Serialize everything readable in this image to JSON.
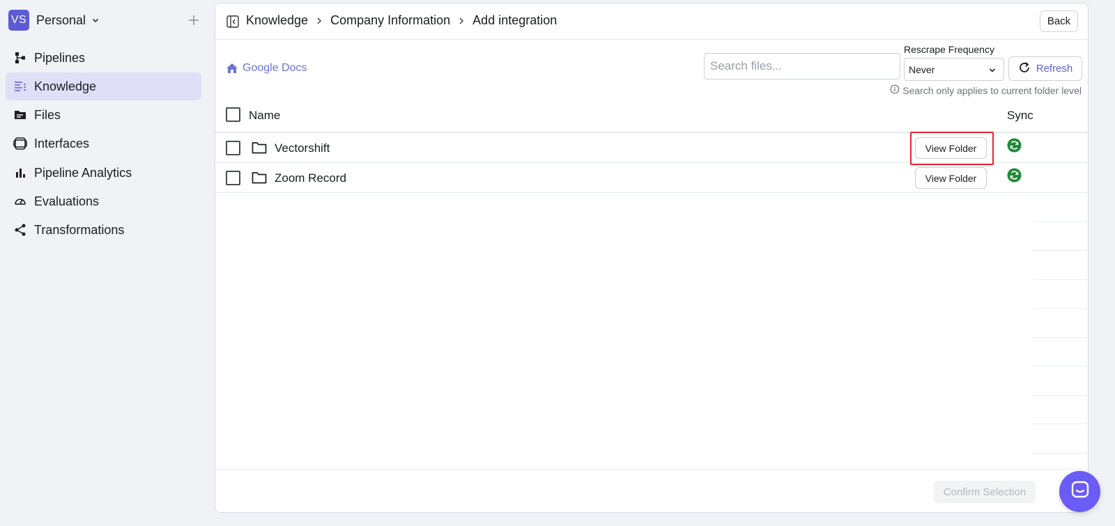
{
  "workspace": {
    "avatar": "VS",
    "name": "Personal"
  },
  "sidebar": {
    "items": [
      {
        "label": "Pipelines",
        "icon": "pipelines-icon"
      },
      {
        "label": "Knowledge",
        "icon": "knowledge-icon",
        "active": true
      },
      {
        "label": "Files",
        "icon": "files-icon"
      },
      {
        "label": "Interfaces",
        "icon": "interfaces-icon"
      },
      {
        "label": "Pipeline Analytics",
        "icon": "analytics-icon"
      },
      {
        "label": "Evaluations",
        "icon": "evaluations-icon"
      },
      {
        "label": "Transformations",
        "icon": "transformations-icon"
      }
    ]
  },
  "header": {
    "breadcrumb": [
      "Knowledge",
      "Company Information",
      "Add integration"
    ],
    "back_label": "Back"
  },
  "toolbar": {
    "home_label": "Google Docs",
    "search_placeholder": "Search files...",
    "frequency_label": "Rescrape Frequency",
    "frequency_value": "Never",
    "refresh_label": "Refresh",
    "search_hint": "Search only applies to current folder level"
  },
  "table": {
    "headers": {
      "name": "Name",
      "sync": "Sync"
    },
    "rows": [
      {
        "name": "Vectorshift",
        "action": "View Folder",
        "sync_status": "synced"
      },
      {
        "name": "Zoom Record",
        "action": "View Folder",
        "sync_status": "synced"
      }
    ]
  },
  "footer": {
    "confirm_label": "Confirm Selection"
  },
  "colors": {
    "accent": "#5b5bd6",
    "link": "#6b74d6",
    "active_nav_bg": "#dfe0f7",
    "sync_green": "#1e8a3a",
    "highlight_red": "#e8232f",
    "chat_bubble": "#6a5cf5"
  }
}
